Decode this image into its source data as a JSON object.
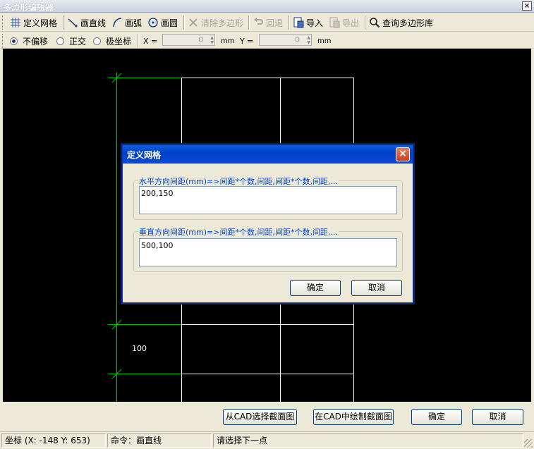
{
  "window": {
    "title": "多边形编辑器",
    "close_label": "×"
  },
  "toolbar": {
    "define_grid": "定义网格",
    "draw_line": "画直线",
    "draw_arc": "画弧",
    "draw_circle": "画圆",
    "clear_polygon": "清除多边形",
    "undo": "回退",
    "import": "导入",
    "export": "导出",
    "query_library": "查询多边形库"
  },
  "options": {
    "no_offset": "不偏移",
    "orthogonal": "正交",
    "polar": "极坐标",
    "selected": "no_offset",
    "x_label": "X =",
    "x_value": "0",
    "x_unit": "mm",
    "y_label": "Y =",
    "y_value": "0",
    "y_unit": "mm"
  },
  "canvas": {
    "grid_color": "#ffffff",
    "dim_color": "#00c000",
    "dim_text": "100"
  },
  "buttons": {
    "select_from_cad": "从CAD选择截面图",
    "draw_in_cad": "在CAD中绘制截面图",
    "ok": "确定",
    "cancel": "取消"
  },
  "status": {
    "coords": "坐标 (X: -148 Y: 653)",
    "command": "命令：画直线",
    "prompt": "请选择下一点"
  },
  "dialog": {
    "title": "定义网格",
    "close_label": "×",
    "horizontal_legend": "水平方向间距(mm)=>间距*个数,间距,间距*个数,间距,...",
    "horizontal_value": "200,150",
    "vertical_legend": "垂直方向间距(mm)=>间距*个数,间距,间距*个数,间距,...",
    "vertical_value": "500,100",
    "ok": "确定",
    "cancel": "取消"
  }
}
